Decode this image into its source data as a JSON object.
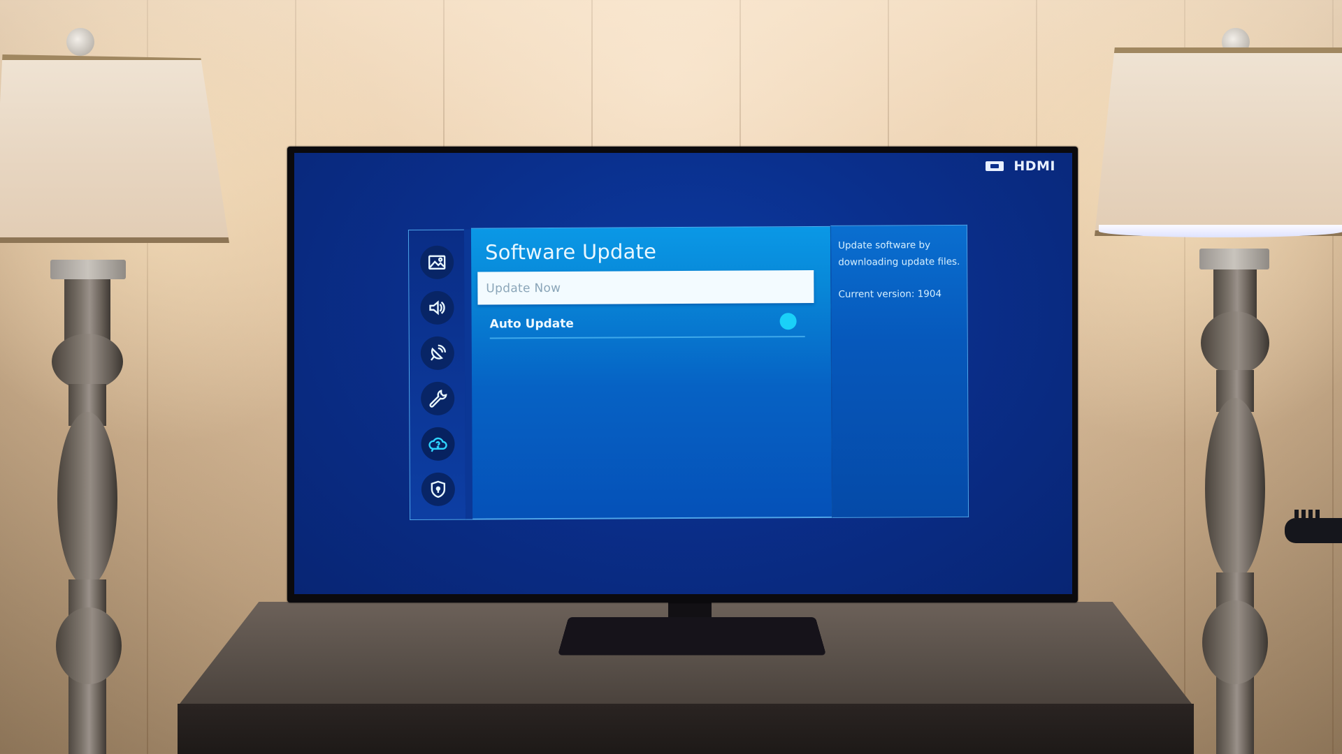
{
  "tv": {
    "source_indicator": {
      "icon": "hdmi-port-icon",
      "label": "HDMI"
    }
  },
  "settings": {
    "sidebar": {
      "items": [
        {
          "name": "picture",
          "icon": "picture-icon",
          "active": false
        },
        {
          "name": "sound",
          "icon": "sound-icon",
          "active": false
        },
        {
          "name": "broadcasting",
          "icon": "satellite-dish-icon",
          "active": false
        },
        {
          "name": "general",
          "icon": "wrench-icon",
          "active": false
        },
        {
          "name": "support",
          "icon": "cloud-question-icon",
          "active": true
        },
        {
          "name": "privacy",
          "icon": "shield-lock-icon",
          "active": false
        }
      ]
    },
    "page_title": "Software Update",
    "menu_items": [
      {
        "label": "Update Now",
        "selected": true
      },
      {
        "label": "Auto Update",
        "selected": false,
        "toggle_on": true
      }
    ],
    "description": {
      "text": "Update software by downloading update files.",
      "version_label": "Current version: 1904"
    },
    "colors": {
      "accent": "#1ad0f8",
      "panel": "#0888d8",
      "screen_bg": "#0a2f8c"
    }
  }
}
